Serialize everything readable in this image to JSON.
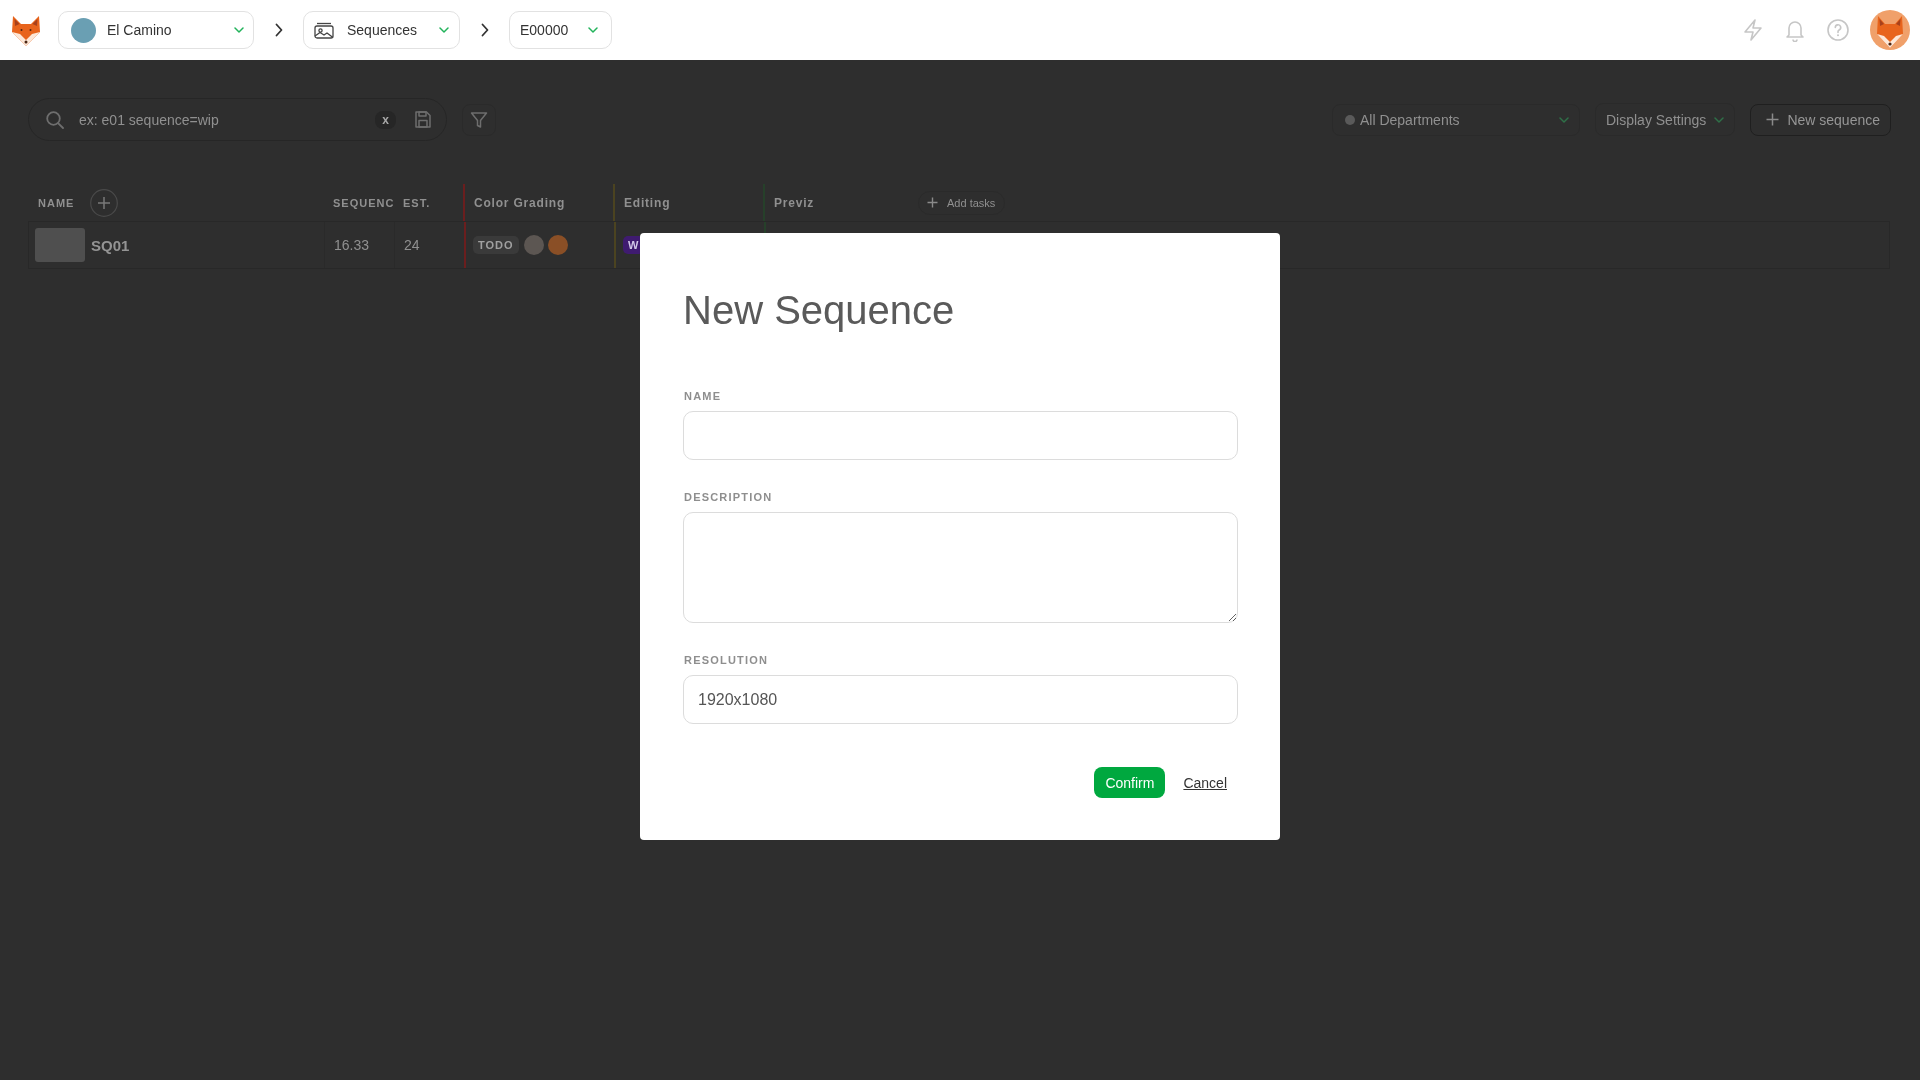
{
  "top_bar": {
    "breadcrumbs": [
      {
        "kind": "project",
        "label": "El Camino"
      },
      {
        "kind": "section",
        "label": "Sequences"
      },
      {
        "kind": "episode",
        "label": "E00000"
      }
    ]
  },
  "toolbar": {
    "search": {
      "placeholder": "ex: e01 sequence=wip",
      "clear_label": "x"
    },
    "department_filter": {
      "value": "All Departments"
    },
    "display_settings": {
      "label": "Display Settings"
    },
    "new_button": {
      "label": "New sequence"
    }
  },
  "table": {
    "columns": [
      {
        "kind": "name",
        "label": "NAME"
      },
      {
        "kind": "stat",
        "label": "SEQUENC"
      },
      {
        "kind": "stat",
        "label": "EST."
      },
      {
        "kind": "task",
        "label": "Color Grading",
        "color": "#6b1e1e"
      },
      {
        "kind": "task",
        "label": "Editing",
        "color": "#4b4320"
      },
      {
        "kind": "task",
        "label": "Previz",
        "color": "#26402a"
      }
    ],
    "add_tasks_label": "Add tasks",
    "rows": [
      {
        "name": "SQ01",
        "values": [
          "16.33",
          "24"
        ],
        "tasks": [
          {
            "kind": "neutral",
            "status": "TODO",
            "color": "#3a3a3a",
            "assignees": [
              {
                "kind": "photo"
              },
              {
                "kind": "fox"
              }
            ]
          },
          {
            "kind": "colored",
            "status": "W",
            "color": "#3f1b70"
          }
        ]
      }
    ]
  },
  "modal": {
    "title": "New Sequence",
    "fields": [
      {
        "kind": "input",
        "label": "NAME"
      },
      {
        "kind": "textarea",
        "label": "DESCRIPTION"
      },
      {
        "kind": "input",
        "label": "RESOLUTION",
        "value": "1920x1080"
      }
    ],
    "buttons": [
      {
        "kind": "primary",
        "label": "Confirm"
      },
      {
        "kind": "link",
        "label": "Cancel"
      }
    ]
  }
}
